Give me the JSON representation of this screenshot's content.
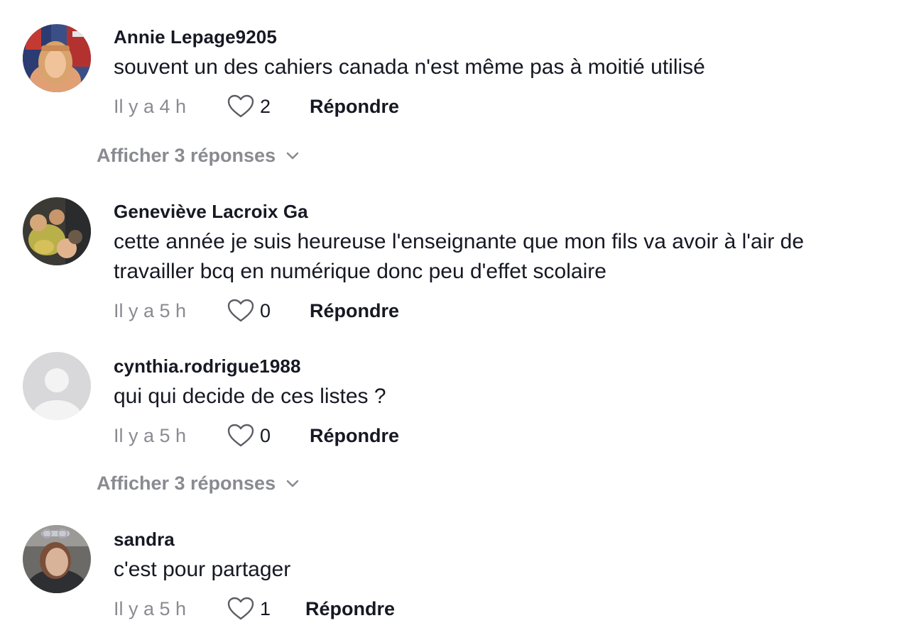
{
  "comments": [
    {
      "username": "Annie Lepage9205",
      "text": "souvent un des cahiers canada n'est même pas à moitié utilisé",
      "time": "Il y a 4 h",
      "likes": "2",
      "reply_label": "Répondre",
      "view_replies": "Afficher 3 réponses"
    },
    {
      "username": "Geneviève Lacroix Ga",
      "text": "cette année je suis heureuse l'enseignante que mon fils va avoir à l'air de travailler bcq en numérique donc peu d'effet scolaire",
      "time": "Il y a 5 h",
      "likes": "0",
      "reply_label": "Répondre"
    },
    {
      "username": "cynthia.rodrigue1988",
      "text": "qui qui decide de ces listes ?",
      "time": "Il y a 5 h",
      "likes": "0",
      "reply_label": "Répondre",
      "view_replies": "Afficher 3 réponses"
    },
    {
      "username": "sandra",
      "text": "c'est pour partager",
      "time": "Il y a 5 h",
      "likes": "1",
      "reply_label": "Répondre"
    }
  ],
  "icons": {
    "like": "heart-outline-icon",
    "expand": "chevron-down-icon",
    "default_avatar": "default-avatar-icon"
  },
  "colors": {
    "primary_text": "#161823",
    "secondary_text": "#8a8b91",
    "background": "#ffffff"
  }
}
